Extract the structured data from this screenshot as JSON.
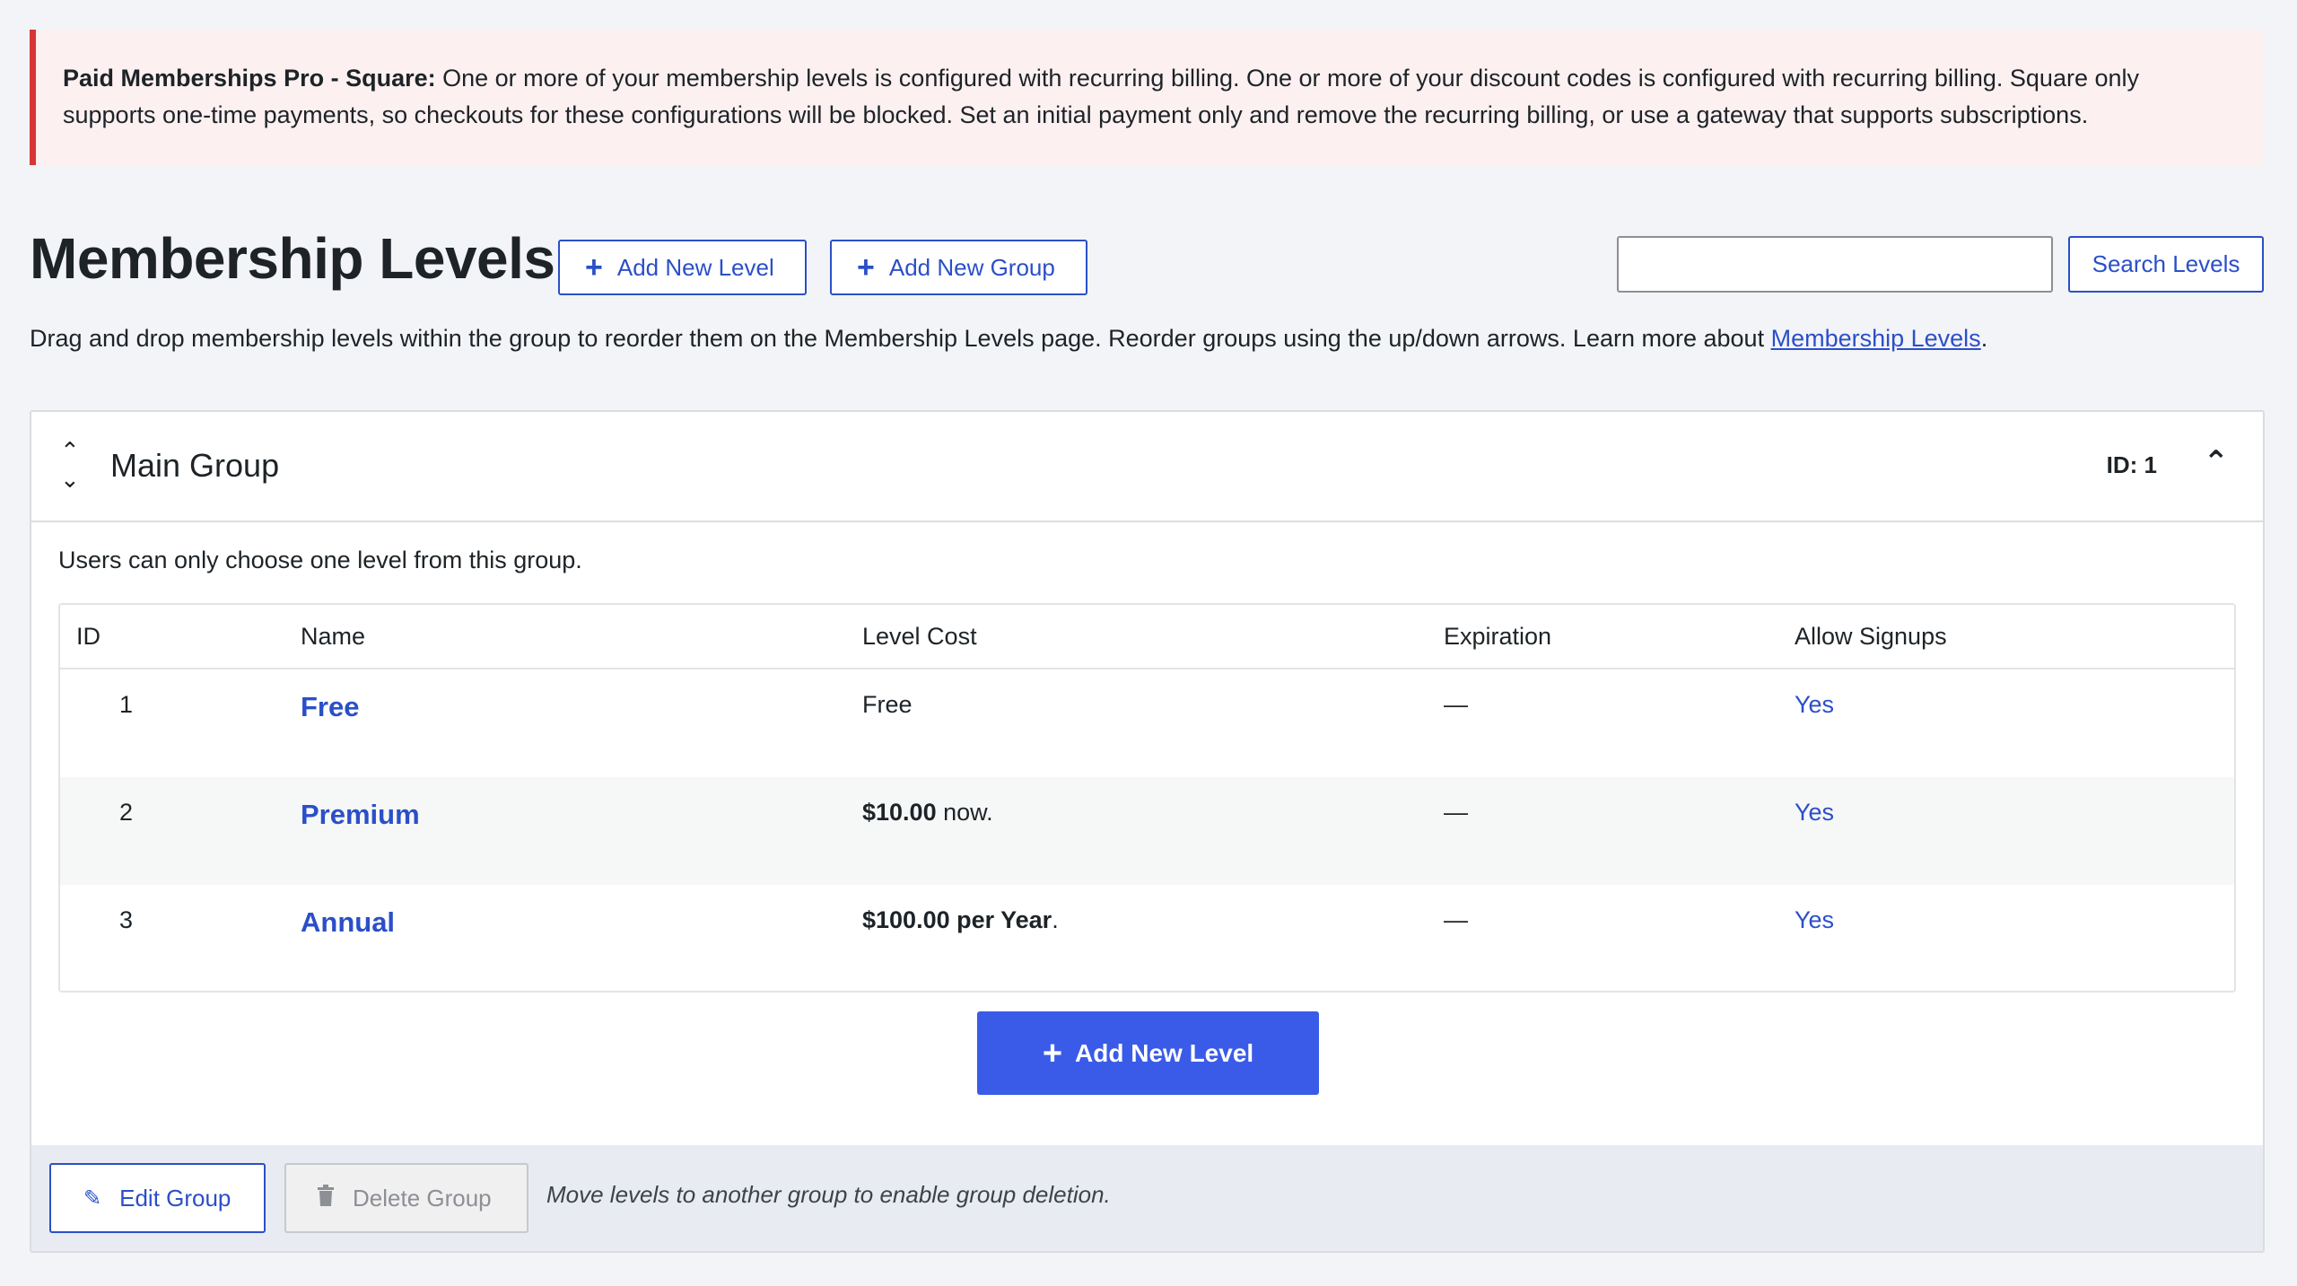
{
  "notice": {
    "bold": "Paid Memberships Pro - Square:",
    "text": " One or more of your membership levels is configured with recurring billing. One or more of your discount codes is configured with recurring billing. Square only supports one-time payments, so checkouts for these configurations will be blocked. Set an initial payment only and remove the recurring billing, or use a gateway that supports subscriptions."
  },
  "header": {
    "title": "Membership Levels",
    "add_level_label": "Add New Level",
    "add_group_label": "Add New Group",
    "search_value": "",
    "search_button": "Search Levels"
  },
  "intro": {
    "text": "Drag and drop membership levels within the group to reorder them on the Membership Levels page. Reorder groups using the up/down arrows. Learn more about ",
    "link": "Membership Levels",
    "after": "."
  },
  "group": {
    "title": "Main Group",
    "id_label": "ID: 1",
    "description": "Users can only choose one level from this group.",
    "columns": [
      "ID",
      "Name",
      "Level Cost",
      "Expiration",
      "Allow Signups"
    ],
    "rows": [
      {
        "id": "1",
        "name": "Free",
        "cost_bold": "",
        "cost_rest": "Free",
        "expiration": "—",
        "signups": "Yes"
      },
      {
        "id": "2",
        "name": "Premium",
        "cost_bold": "$10.00",
        "cost_rest": " now.",
        "expiration": "—",
        "signups": "Yes"
      },
      {
        "id": "3",
        "name": "Annual",
        "cost_bold": "$100.00 per Year",
        "cost_rest": ".",
        "expiration": "—",
        "signups": "Yes"
      }
    ],
    "add_level_label": "Add New Level",
    "edit_label": "Edit Group",
    "delete_label": "Delete Group",
    "footer_note": "Move levels to another group to enable group deletion."
  },
  "colors": {
    "accent": "#2b4fc8",
    "primary_button": "#3a5be8",
    "error": "#d63638"
  },
  "icons": {
    "plus": "plus-icon",
    "pencil": "pencil-icon",
    "trash": "trash-icon",
    "chevron_up": "chevron-up-icon",
    "chevron_down": "chevron-down-icon"
  }
}
